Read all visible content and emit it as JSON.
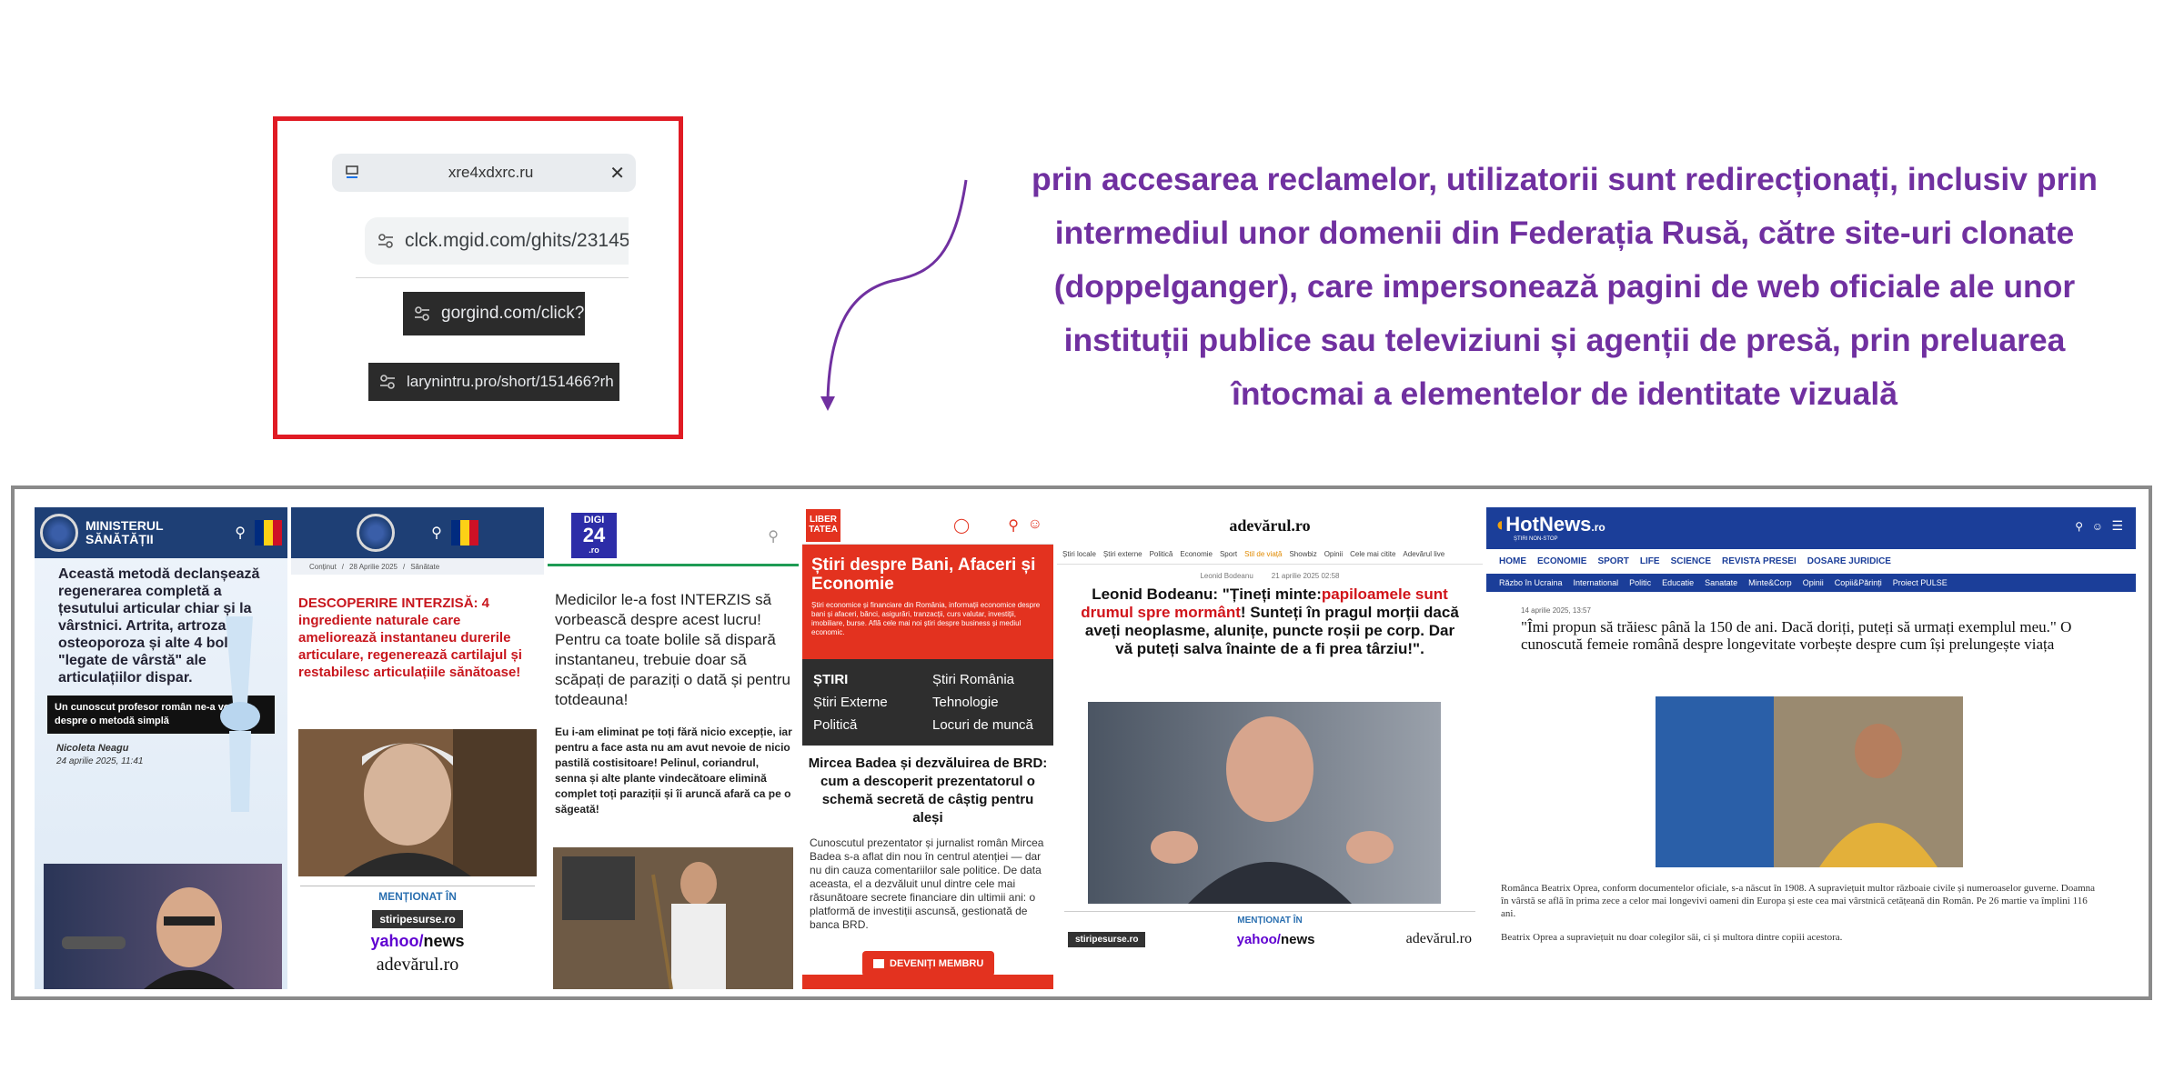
{
  "redirect_chain": {
    "url_1": "xre4xdxrc.ru",
    "url_2": "clck.mgid.com/ghits/23145",
    "url_3": "gorgind.com/click?",
    "url_4": "larynintru.pro/short/151466?rh"
  },
  "caption": [
    "prin accesarea reclamelor, utilizatorii sunt redirecționați, inclusiv prin",
    "intermediul unor domenii din Federația Rusă, către site-uri clonate",
    "(doppelganger), care impersonează pagini de web oficiale ale unor",
    "instituții publice sau televiziuni și agenții de presă, prin preluarea",
    "întocmai a elementelor de identitate vizuală"
  ],
  "panels": {
    "ministry": {
      "site_name": "MINISTERUL SĂNĂTĂȚII",
      "body": "Această metodă declanșează regenerarea completă a țesutului articular chiar și la vârstnici. Artrita, artroza, osteoporoza și alte 4 boli \"legate de vârstă\" ale articulațiilor dispar.",
      "banner": "Un cunoscut profesor român ne-a vorbit despre o metodă simplă",
      "author": "Nicoleta Neagu",
      "date": "24 aprilie 2025, 11:41"
    },
    "ministry_2": {
      "breadcrumb_1": "Conținut",
      "breadcrumb_2": "28 Aprilie 2025",
      "breadcrumb_3": "Sănătate",
      "headline_red": "DESCOPERIRE INTERZISĂ: 4 ingrediente naturale care ameliorează instantaneu durerile articulare, regenerează cartilajul și restabilesc articulațiile sănătoase!",
      "mentioned": "MENȚIONAT ÎN",
      "logo_1": "stiripesurse.ro",
      "logo_2a": "yahoo/",
      "logo_2b": "news",
      "logo_3": "adevărul.ro"
    },
    "digi24": {
      "logo_top": "DIGI",
      "logo_num": "24",
      "logo_ro": ".ro",
      "headline": "Medicilor le-a fost INTERZIS să vorbească despre acest lucru! Pentru ca toate bolile să dispară instantaneu, trebuie doar să scăpați de paraziți o dată și pentru totdeauna!",
      "bold_text": "Eu i-am eliminat pe toți fără nicio excepție, iar pentru a face asta nu am avut nevoie de nicio pastilă costisitoare! Pelinul, coriandrul, senna și alte plante vindecătoare elimină complet toți paraziții și îi aruncă afară ca pe o săgeată!"
    },
    "libertatea": {
      "logo": "LIBER TATEA",
      "section_title": "Știri despre Bani, Afaceri și Economie",
      "section_desc": "Știri economice și financiare din România, informații economice despre bani și afaceri, bănci, asigurări, tranzacții, curs valutar, investiții, imobiliare, burse. Află cele mai noi știri despre business și mediul economic.",
      "menu": [
        "ȘTIRI",
        "Știri România",
        "Știri Externe",
        "Tehnologie",
        "Politică",
        "Locuri de muncă"
      ],
      "headline": "Mircea Badea și dezvăluirea de BRD: cum a descoperit prezentatorul o schemă secretă de câștig pentru aleși",
      "body": "Cunoscutul prezentator și jurnalist român Mircea Badea s-a aflat din nou în centrul atenției — dar nu din cauza comentariilor sale politice. De data aceasta, el a dezvăluit unul dintre cele mai răsunătoare secrete financiare din ultimii ani: o platformă de investiții ascunsă, gestionată de banca BRD.",
      "cta": "DEVENIȚI MEMBRU"
    },
    "adevarul": {
      "logo": "adevărul.ro",
      "nav": [
        "Știri locale",
        "Știri externe",
        "Politică",
        "Economie",
        "Sport",
        "Stil de viață",
        "Showbiz",
        "Opinii",
        "Cele mai citite",
        "Adevărul live"
      ],
      "byline": "Leonid Bodeanu",
      "byline_date": "21 aprilie 2025 02:58",
      "headline_black_1": "Leonid Bodeanu: \"Țineți minte:",
      "headline_red": "papiloamele sunt drumul spre mormânt",
      "headline_black_2": "! Sunteți în pragul morții dacă aveți neoplasme, alunițe, puncte roșii pe corp. Dar vă puteți salva înainte de a fi prea târziu!\".",
      "mentioned": "MENȚIONAT ÎN",
      "logo_1": "stiripesurse.ro",
      "logo_2a": "yahoo/",
      "logo_2b": "news",
      "logo_3": "adevărul.ro"
    },
    "hotnews": {
      "logo": "HotNews",
      "logo_suffix": ".ro",
      "tagline": "ȘTIRI NON-STOP",
      "nav": [
        "HOME",
        "ECONOMIE",
        "SPORT",
        "LIFE",
        "SCIENCE",
        "REVISTA PRESEI",
        "DOSARE JURIDICE"
      ],
      "subnav": [
        "Războ în Ucraina",
        "International",
        "Politic",
        "Educatie",
        "Sanatate",
        "Minte&Corp",
        "Opinii",
        "Copii&Părinți",
        "Proiect PULSE"
      ],
      "date": "14 aprilie 2025, 13:57",
      "headline": "\"Îmi propun să trăiesc până la 150 de ani. Dacă doriți, puteți să urmați exemplul meu.\" O cunoscută femeie română despre longevitate vorbește despre cum își prelungește viața",
      "body_1": "Românca Beatrix Oprea, conform documentelor oficiale, s-a născut în 1908. A supraviețuit multor războaie civile și numeroaselor guverne. Doamna în vârstă se află în prima zece a celor mai longevivi oameni din Europa și este cea mai vârstnică cetățeană din Român. Pe 26 martie va împlini 116 ani.",
      "body_2": "Beatrix Oprea a supraviețuit nu doar colegilor săi, ci și multora dintre copiii acestora."
    }
  },
  "colors": {
    "caption": "#7030a0",
    "box_border": "#e01b24",
    "gov_blue": "#1e3f75",
    "libertatea_red": "#e3321f",
    "hotnews_blue": "#1b3e99"
  }
}
